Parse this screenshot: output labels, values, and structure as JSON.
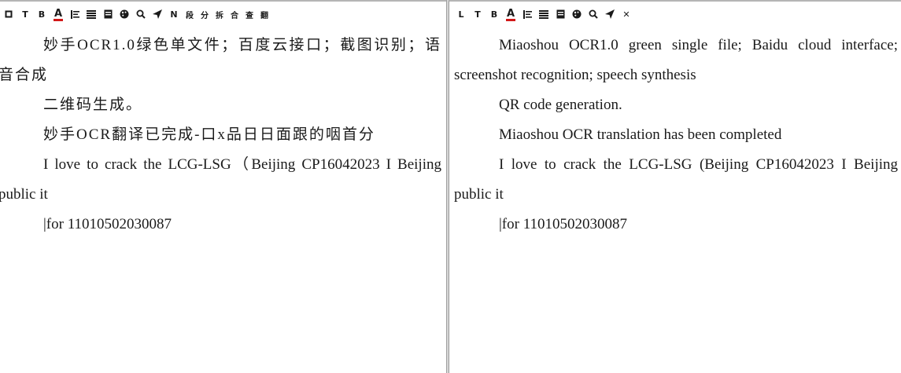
{
  "left_pane": {
    "toolbar": [
      {
        "name": "copy-icon",
        "glyph": "square"
      },
      {
        "name": "text-tool-button",
        "label": "T"
      },
      {
        "name": "bold-button",
        "label": "B"
      },
      {
        "name": "font-color-button",
        "label": "A"
      },
      {
        "name": "align-left-icon",
        "glyph": "lines"
      },
      {
        "name": "align-justify-icon",
        "glyph": "block"
      },
      {
        "name": "document-icon",
        "glyph": "doc"
      },
      {
        "name": "palette-icon",
        "glyph": "palette"
      },
      {
        "name": "search-icon",
        "glyph": "search"
      },
      {
        "name": "send-icon",
        "glyph": "send"
      },
      {
        "name": "n-button",
        "label": "N"
      },
      {
        "name": "segment-button",
        "label": "段"
      },
      {
        "name": "split-button",
        "label": "分"
      },
      {
        "name": "dismantle-button",
        "label": "拆"
      },
      {
        "name": "merge-button",
        "label": "合"
      },
      {
        "name": "check-button",
        "label": "查"
      },
      {
        "name": "translate-button",
        "label": "翻"
      }
    ],
    "paragraphs": [
      "妙手OCR1.0绿色单文件；百度云接口；截图识别；语音合成",
      "二维码生成。",
      "妙手OCR翻译已完成-口x品日日面跟的咽首分",
      "I love to crack the LCG-LSG（Beijing CP16042023 I Beijing public it",
      "|for 11010502030087"
    ]
  },
  "right_pane": {
    "toolbar": [
      {
        "name": "l-button",
        "label": "L"
      },
      {
        "name": "text-tool-button",
        "label": "T"
      },
      {
        "name": "bold-button",
        "label": "B"
      },
      {
        "name": "font-color-button",
        "label": "A"
      },
      {
        "name": "align-left-icon",
        "glyph": "lines"
      },
      {
        "name": "align-justify-icon",
        "glyph": "block"
      },
      {
        "name": "document-icon",
        "glyph": "doc"
      },
      {
        "name": "palette-icon",
        "glyph": "palette"
      },
      {
        "name": "search-icon",
        "glyph": "search"
      },
      {
        "name": "send-icon",
        "glyph": "send"
      },
      {
        "name": "close-icon",
        "label": "✕"
      }
    ],
    "paragraphs": [
      "Miaoshou OCR1.0 green single file; Baidu cloud interface; screenshot recognition; speech synthesis",
      "QR code generation.",
      "Miaoshou OCR translation has been completed",
      "I love to crack the LCG-LSG (Beijing CP16042023 I Beijing public it",
      "|for 11010502030087"
    ]
  },
  "colors": {
    "text": "#1a1a1a",
    "font_color_underline": "#d21818",
    "border": "#b5b5b5"
  }
}
